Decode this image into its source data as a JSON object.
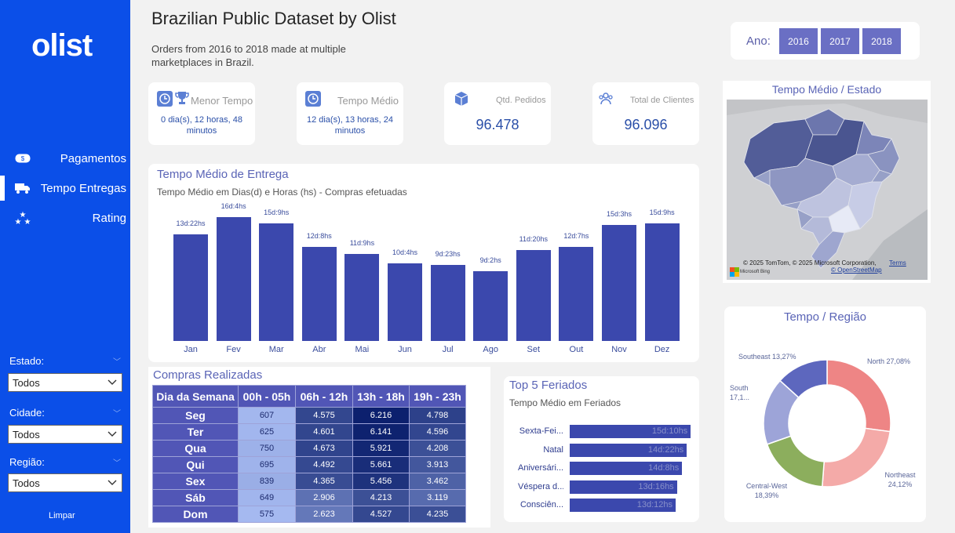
{
  "sidebar": {
    "logo": "olist",
    "nav": [
      {
        "label": "Pagamentos",
        "icon": "money-icon"
      },
      {
        "label": "Tempo Entregas",
        "icon": "truck-icon"
      },
      {
        "label": "Rating",
        "icon": "stars-icon"
      }
    ],
    "filters": [
      {
        "label": "Estado:",
        "value": "Todos"
      },
      {
        "label": "Cidade:",
        "value": "Todos"
      },
      {
        "label": "Região:",
        "value": "Todos"
      }
    ],
    "clear_label": "Limpar"
  },
  "header": {
    "title": "Brazilian Public Dataset by Olist",
    "subtitle": "Orders from 2016 to 2018 made at multiple marketplaces in Brazil."
  },
  "year_filter": {
    "label": "Ano:",
    "years": [
      "2016",
      "2017",
      "2018"
    ]
  },
  "kpis": {
    "menor_tempo": {
      "title": "Menor Tempo",
      "value": "0 dia(s), 12 horas, 48 minutos"
    },
    "tempo_medio": {
      "title": "Tempo Médio",
      "value": "12 dia(s), 13 horas, 24 minutos"
    },
    "pedidos": {
      "title": "Qtd. Pedidos",
      "value": "96.478"
    },
    "clientes": {
      "title": "Total de Clientes",
      "value": "96.096"
    }
  },
  "map": {
    "title": "Tempo Médio / Estado",
    "attribution": "© 2025 TomTom, © 2025 Microsoft Corporation,",
    "terms": "Terms",
    "osm": "© OpenStreetMap",
    "brand": "Microsoft Bing"
  },
  "delivery": {
    "title": "Tempo Médio de Entrega",
    "subtitle": "Tempo Médio em Dias(d) e Horas (hs) - Compras efetuadas"
  },
  "chart_data": [
    {
      "type": "bar",
      "categories": [
        "Jan",
        "Fev",
        "Mar",
        "Abr",
        "Mai",
        "Jun",
        "Jul",
        "Ago",
        "Set",
        "Out",
        "Nov",
        "Dez"
      ],
      "values": [
        13.92,
        16.17,
        15.38,
        12.33,
        11.38,
        10.17,
        9.96,
        9.08,
        11.83,
        12.29,
        15.13,
        15.38
      ],
      "data_labels": [
        "13d:22hs",
        "16d:4hs",
        "15d:9hs",
        "12d:8hs",
        "11d:9hs",
        "10d:4hs",
        "9d:23hs",
        "9d:2hs",
        "11d:20hs",
        "12d:7hs",
        "15d:3hs",
        "15d:9hs"
      ],
      "ylim": [
        0,
        17
      ],
      "grid": false
    },
    {
      "type": "bar",
      "orientation": "horizontal",
      "categories": [
        "Sexta-Fei...",
        "Natal",
        "Aniversári...",
        "Véspera d...",
        "Consciên..."
      ],
      "values": [
        15.42,
        14.92,
        14.33,
        13.67,
        13.5
      ],
      "data_labels": [
        "15d:10hs",
        "14d:22hs",
        "14d:8hs",
        "13d:16hs",
        "13d:12hs"
      ]
    },
    {
      "type": "pie",
      "donut": true,
      "categories": [
        "North",
        "Northeast",
        "Central-West",
        "South",
        "Southeast"
      ],
      "values": [
        27.08,
        24.12,
        18.39,
        17.1,
        13.27
      ],
      "colors": [
        "#ee8585",
        "#f4aaa8",
        "#8cae5d",
        "#9da4d8",
        "#5d67be"
      ]
    }
  ],
  "purchases": {
    "title": "Compras Realizadas",
    "columns": [
      "Dia da Semana",
      "00h - 05h",
      "06h - 12h",
      "13h - 18h",
      "19h - 23h"
    ],
    "rows": [
      {
        "day": "Seg",
        "values": [
          "607",
          "4.575",
          "6.216",
          "4.798"
        ]
      },
      {
        "day": "Ter",
        "values": [
          "625",
          "4.601",
          "6.141",
          "4.596"
        ]
      },
      {
        "day": "Qua",
        "values": [
          "750",
          "4.673",
          "5.921",
          "4.208"
        ]
      },
      {
        "day": "Qui",
        "values": [
          "695",
          "4.492",
          "5.661",
          "3.913"
        ]
      },
      {
        "day": "Sex",
        "values": [
          "839",
          "4.365",
          "5.456",
          "3.462"
        ]
      },
      {
        "day": "Sáb",
        "values": [
          "649",
          "2.906",
          "4.213",
          "3.119"
        ]
      },
      {
        "day": "Dom",
        "values": [
          "575",
          "2.623",
          "4.527",
          "4.235"
        ]
      }
    ]
  },
  "holidays": {
    "title": "Top 5 Feriados",
    "subtitle": "Tempo Médio em Feriados"
  },
  "region": {
    "title": "Tempo / Região",
    "labels": {
      "north": "North 27,08%",
      "northeast_name": "Northeast",
      "northeast_pct": "24,12%",
      "centralwest_name": "Central-West",
      "centralwest_pct": "18,39%",
      "south_name": "South",
      "south_pct": "17,1...",
      "southeast": "Southeast 13,27%"
    }
  }
}
